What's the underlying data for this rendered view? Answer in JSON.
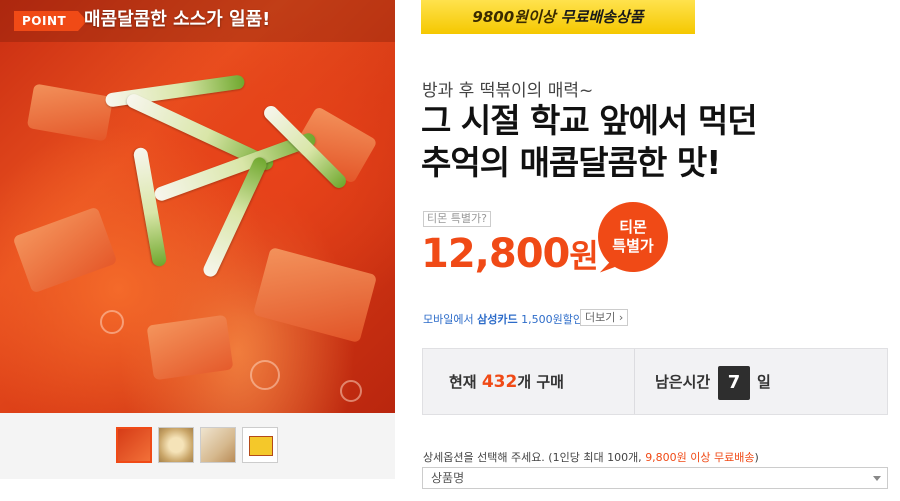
{
  "hero": {
    "point_tag": "POINT",
    "point_text": "매콤달콤한 소스가 일품!"
  },
  "thumbnails": [
    "tteokbokki-soup",
    "dumpling-plate",
    "dumplings",
    "package"
  ],
  "shipping_banner": {
    "prefix": "9800원이상 ",
    "highlight": "무료배송상품"
  },
  "product": {
    "subtitle": "방과 후 떡볶이의 매력~",
    "title_line1": "그 시절 학교 앞에서 먹던",
    "title_line2": "추억의 매콤달콤한 맛!",
    "price_label": "티몬 특별가?",
    "price_value": "12,800",
    "price_unit": "원",
    "badge_line1": "티몬",
    "badge_line2": "특별가"
  },
  "promo": {
    "prefix": "모바일에서 ",
    "card": "삼성카드",
    "suffix": " 1,500원할인!",
    "more_label": "더보기 ›"
  },
  "status": {
    "current_label": "현재 ",
    "current_count": "432",
    "current_suffix": "개 구매",
    "remain_label": "남은시간",
    "remain_days": "7",
    "remain_unit": "일"
  },
  "option": {
    "note_prefix": "상세옵션을 선택해 주세요. (1인당 최대 100개, ",
    "note_highlight": "9,800원 이상 무료배송",
    "note_suffix": ")",
    "select_placeholder": "상품명"
  },
  "colors": {
    "accent": "#f04a16",
    "banner_yellow": "#ffd91a",
    "link_blue": "#2d6cc9"
  }
}
